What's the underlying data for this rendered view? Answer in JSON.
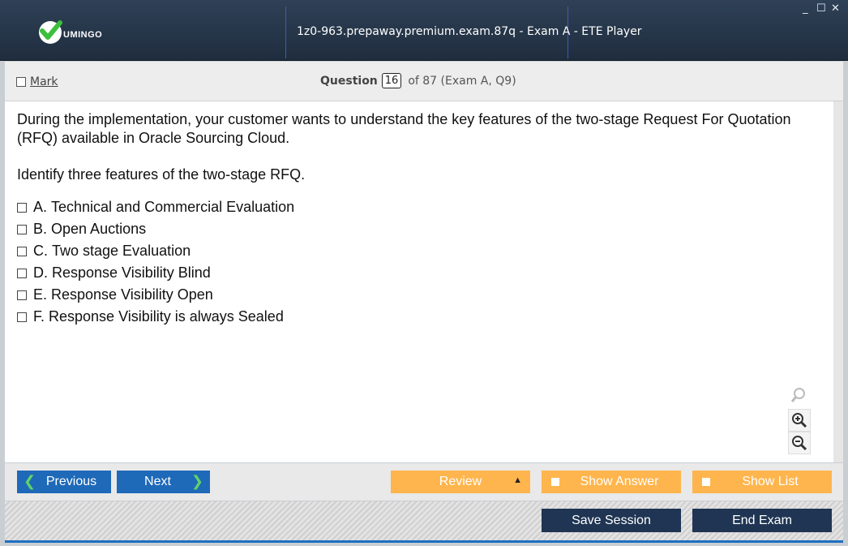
{
  "window": {
    "title": "1z0-963.prepaway.premium.exam.87q - Exam A - ETE Player",
    "brand": "UMINGO",
    "controls": {
      "minimize": "_",
      "maximize": "☐",
      "close": "✕"
    }
  },
  "header": {
    "mark_label": "Mark",
    "question_label": "Question",
    "question_number": "16",
    "question_of": "of 87 (Exam A, Q9)"
  },
  "question": {
    "text": "During the implementation, your customer wants to understand the key features of the two-stage Request For Quotation (RFQ) available in Oracle Sourcing Cloud.",
    "instruction": "Identify three features of the two-stage RFQ.",
    "options": [
      {
        "letter": "A.",
        "text": "Technical and Commercial Evaluation"
      },
      {
        "letter": "B.",
        "text": "Open Auctions"
      },
      {
        "letter": "C.",
        "text": "Two stage Evaluation"
      },
      {
        "letter": "D.",
        "text": "Response Visibility Blind"
      },
      {
        "letter": "E.",
        "text": "Response Visibility Open"
      },
      {
        "letter": "F.",
        "text": "Response Visibility is always Sealed"
      }
    ]
  },
  "nav": {
    "previous_label": "Previous",
    "next_label": "Next",
    "review_label": "Review",
    "show_answer_label": "Show Answer",
    "show_list_label": "Show List"
  },
  "footer": {
    "save_label": "Save Session",
    "end_label": "End Exam"
  },
  "colors": {
    "title_bg": "#263649",
    "nav_blue": "#1e69b8",
    "orange": "#ffb54d",
    "dark_button": "#1f3553",
    "accent_green": "#5fd36a"
  }
}
